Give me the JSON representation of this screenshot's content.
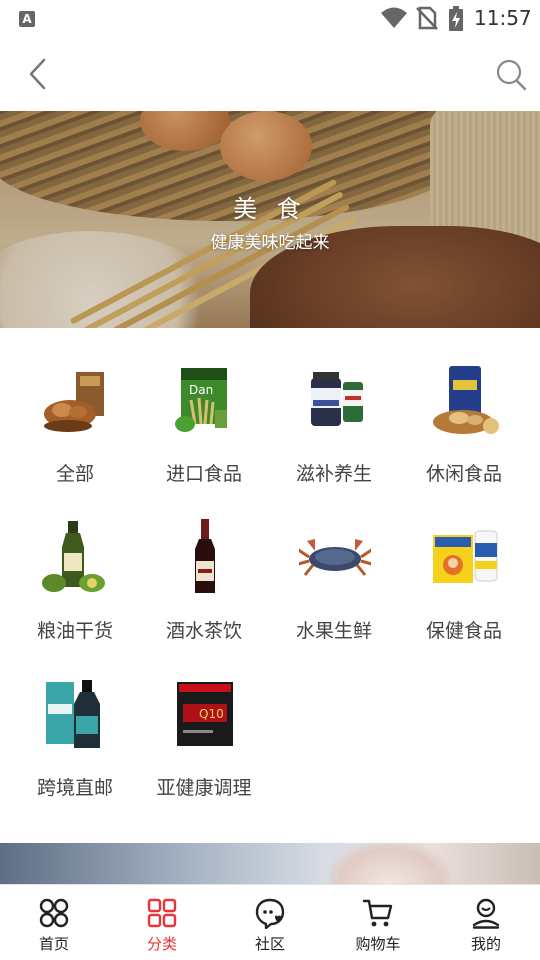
{
  "status_bar": {
    "time": "11:57",
    "app_icon_letter": "A"
  },
  "nav": {
    "back_icon": "chevron-left-icon",
    "search_icon": "search-icon"
  },
  "banner": {
    "title": "美 食",
    "subtitle": "健康美味吃起来"
  },
  "categories": [
    {
      "label": "全部",
      "icon": "nuts-gift-box-image"
    },
    {
      "label": "进口食品",
      "icon": "imported-snack-box-image"
    },
    {
      "label": "滋补养生",
      "icon": "supplement-bottles-image"
    },
    {
      "label": "休闲食品",
      "icon": "crackers-snack-image"
    },
    {
      "label": "粮油干货",
      "icon": "olive-oil-bottle-image"
    },
    {
      "label": "酒水茶饮",
      "icon": "wine-bottle-image"
    },
    {
      "label": "水果生鲜",
      "icon": "crab-image"
    },
    {
      "label": "保健食品",
      "icon": "vitamin-pack-image"
    },
    {
      "label": "跨境直邮",
      "icon": "cross-border-bottle-image"
    },
    {
      "label": "亚健康调理",
      "icon": "q10-box-image"
    }
  ],
  "tabbar": {
    "active_color": "#e8343b",
    "items": [
      {
        "label": "首页",
        "icon": "home-icon",
        "active": false
      },
      {
        "label": "分类",
        "icon": "category-grid-icon",
        "active": true
      },
      {
        "label": "社区",
        "icon": "community-chat-icon",
        "active": false
      },
      {
        "label": "购物车",
        "icon": "cart-icon",
        "active": false
      },
      {
        "label": "我的",
        "icon": "profile-icon",
        "active": false
      }
    ]
  }
}
